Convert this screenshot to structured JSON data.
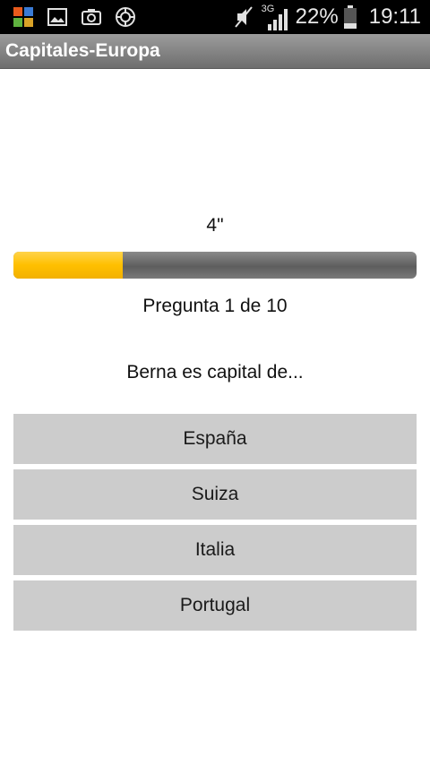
{
  "status_bar": {
    "left_icons": [
      "avast-icon",
      "gallery-icon",
      "camera-icon",
      "sync-icon"
    ],
    "network_type": "3G",
    "battery_percent": "22%",
    "time": "19:11"
  },
  "action_bar": {
    "title": "Capitales-Europa"
  },
  "quiz": {
    "timer": "4\"",
    "progress": 0.27,
    "counter": "Pregunta 1 de 10",
    "question": "Berna es capital de...",
    "answers": [
      "España",
      "Suiza",
      "Italia",
      "Portugal"
    ]
  },
  "colors": {
    "progress_fill": "#ffc000",
    "progress_track": "#6e6e6e",
    "answer_bg": "#cccccc"
  }
}
